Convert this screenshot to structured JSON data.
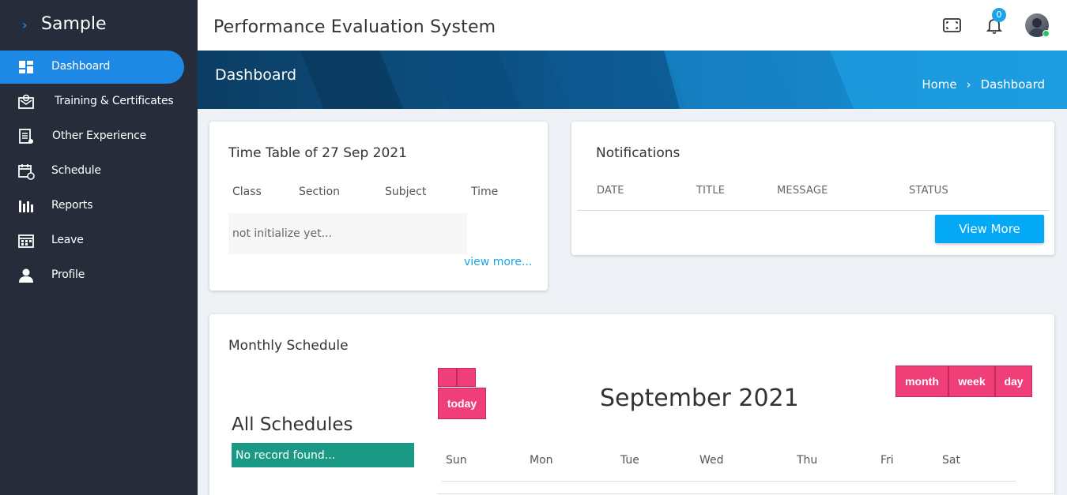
{
  "brand": {
    "title": "Sample"
  },
  "sidebar": {
    "items": [
      {
        "label": "Dashboard"
      },
      {
        "label": "Training & Certificates"
      },
      {
        "label": "Other Experience"
      },
      {
        "label": "Schedule"
      },
      {
        "label": "Reports"
      },
      {
        "label": "Leave"
      },
      {
        "label": "Profile"
      }
    ]
  },
  "header": {
    "app_title": "Performance Evaluation System",
    "notification_count": "0"
  },
  "banner": {
    "page_title": "Dashboard",
    "breadcrumb": [
      "Home",
      "Dashboard"
    ],
    "separator": "›"
  },
  "timetable": {
    "title": "Time Table of 27 Sep 2021",
    "columns": [
      "Class",
      "Section",
      "Subject",
      "Time"
    ],
    "empty_text": "not initialize yet...",
    "view_more": "view more..."
  },
  "notifications": {
    "title": "Notifications",
    "columns": [
      "DATE",
      "TITLE",
      "MESSAGE",
      "STATUS"
    ],
    "view_more": "View More"
  },
  "schedule": {
    "title": "Monthly Schedule",
    "all_title": "All Schedules",
    "no_record": "No record found...",
    "today": "today",
    "views": [
      "month",
      "week",
      "day"
    ],
    "month_title": "September 2021",
    "days": [
      "Sun",
      "Mon",
      "Tue",
      "Wed",
      "Thu",
      "Fri",
      "Sat"
    ]
  },
  "colors": {
    "sidebar_bg": "#262c3a",
    "accent": "#1e88e5",
    "calendar_button": "#ef3e78",
    "no_record_bg": "#1a9a85"
  }
}
